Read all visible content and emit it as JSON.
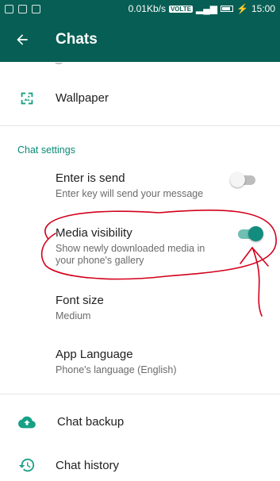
{
  "status_bar": {
    "speed": "0.01Kb/s",
    "network_badge": "VOLTE",
    "time": "15:00"
  },
  "app_bar": {
    "back_icon": "arrow-left-icon",
    "title": "Chats"
  },
  "rows": {
    "wallpaper": {
      "title": "Wallpaper",
      "icon": "wallpaper-icon"
    },
    "chat_settings_header": "Chat settings",
    "enter_is_send": {
      "title": "Enter is send",
      "subtitle": "Enter key will send your message",
      "enabled": false
    },
    "media_visibility": {
      "title": "Media visibility",
      "subtitle_line1": "Show newly downloaded media in",
      "subtitle_line2": "your phone's gallery",
      "enabled": true
    },
    "font_size": {
      "title": "Font size",
      "value": "Medium"
    },
    "app_language": {
      "title": "App Language",
      "value": "Phone's language (English)"
    },
    "chat_backup": {
      "title": "Chat backup",
      "icon": "cloud-upload-icon"
    },
    "chat_history": {
      "title": "Chat history",
      "icon": "history-icon"
    }
  },
  "colors": {
    "primary": "#075e54",
    "accent": "#128c7e",
    "annotation": "#d3001b"
  }
}
